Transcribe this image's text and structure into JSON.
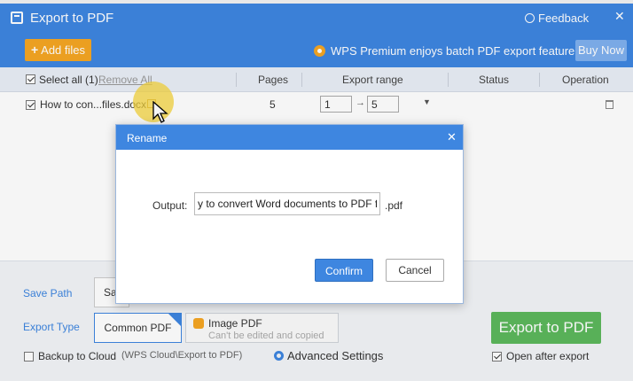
{
  "window": {
    "title": "Export to PDF",
    "feedback": "Feedback",
    "close": "✕"
  },
  "toolbar": {
    "add_files": "Add files",
    "add_plus": "+",
    "premium_text": "WPS Premium enjoys batch PDF export feature.",
    "buy_now": "Buy Now"
  },
  "table": {
    "select_all": "Select all (1)",
    "remove_all": "Remove All",
    "columns": [
      "Pages",
      "Export range",
      "Status",
      "Operation"
    ],
    "rows": [
      {
        "name": "How to con...files.docx",
        "pages": "5",
        "range_from": "1",
        "range_to": "5",
        "range_arrow": "→",
        "dropdown": "▼"
      }
    ]
  },
  "settings": {
    "save_path_label": "Save Path",
    "save_path_value": "Sa",
    "export_type_label": "Export Type",
    "common_pdf": "Common PDF",
    "image_pdf_title": "Image PDF",
    "image_pdf_sub": "Can't be edited and copied",
    "backup_label": "Backup to Cloud",
    "backup_path": "(WPS Cloud\\Export to PDF)",
    "advanced_settings": "Advanced Settings",
    "export_button": "Export to PDF",
    "open_after": "Open after export"
  },
  "dialog": {
    "title": "Rename",
    "close": "✕",
    "output_label": "Output:",
    "output_value": "y to convert Word documents to PDF files",
    "extension": ".pdf",
    "confirm": "Confirm",
    "cancel": "Cancel"
  },
  "colors": {
    "accent": "#3e86e0",
    "add_files": "#f5a623",
    "export": "#5cb85c"
  }
}
